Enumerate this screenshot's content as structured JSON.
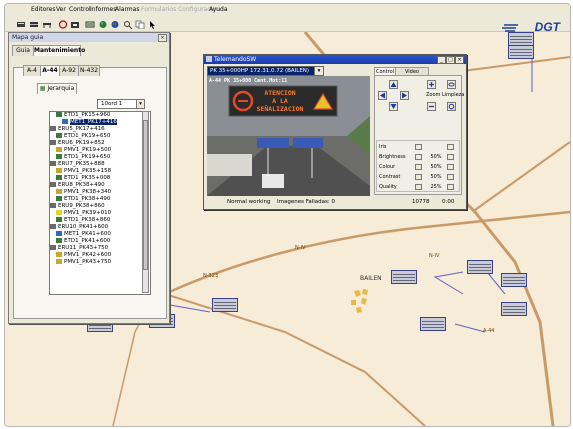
{
  "menu": [
    {
      "label": "Editores",
      "disabled": false
    },
    {
      "label": "Ver",
      "disabled": false
    },
    {
      "label": "Control",
      "disabled": false
    },
    {
      "label": "Informes",
      "disabled": false
    },
    {
      "label": "Alarmas",
      "disabled": false
    },
    {
      "label": "Formularios Configuracion",
      "disabled": true
    },
    {
      "label": "Ayuda",
      "disabled": false
    }
  ],
  "toolbar_icons": [
    "new-icon",
    "open-icon",
    "road-icon",
    "stop-icon",
    "camera-icon",
    "panel-icon",
    "globe-icon",
    "earth-icon",
    "zoom-icon",
    "copy-icon",
    "pointer-icon"
  ],
  "logo": "DGT",
  "tool_window": {
    "title": "Mapa guia",
    "tabs": [
      "Guia",
      "Mantenimiento"
    ],
    "road_tabs": [
      "A-4",
      "A-44",
      "A-92",
      "N-432"
    ],
    "subtab": "Jerarquia",
    "filter": "10ord 1",
    "tree": [
      {
        "label": "ETD1_PK15+960",
        "indent": 1,
        "icon": "station"
      },
      {
        "label": "MET1_PK17+416",
        "indent": 2,
        "icon": "meteo",
        "selected": true
      },
      {
        "label": "ERU5_PK17+416",
        "indent": 0,
        "icon": "eru"
      },
      {
        "label": "ETD1_PK19+650",
        "indent": 1,
        "icon": "station"
      },
      {
        "label": "ERU6_PK19+852",
        "indent": 0,
        "icon": "eru"
      },
      {
        "label": "PMV1_PK19+500",
        "indent": 1,
        "icon": "panel"
      },
      {
        "label": "ETD1_PK19+650",
        "indent": 1,
        "icon": "station"
      },
      {
        "label": "ERU7_PK35+888",
        "indent": 0,
        "icon": "eru"
      },
      {
        "label": "PMV1_PK35+158",
        "indent": 1,
        "icon": "panel"
      },
      {
        "label": "ETD1_PK35+008",
        "indent": 1,
        "icon": "station"
      },
      {
        "label": "ERU8_PK38+490",
        "indent": 0,
        "icon": "eru"
      },
      {
        "label": "PMV1_PK38+340",
        "indent": 1,
        "icon": "panel"
      },
      {
        "label": "ETD1_PK38+490",
        "indent": 1,
        "icon": "station"
      },
      {
        "label": "ERU9_PK38+860",
        "indent": 0,
        "icon": "eru"
      },
      {
        "label": "PMV1_PK39+010",
        "indent": 1,
        "icon": "panel-warn"
      },
      {
        "label": "ETD1_PK38+860",
        "indent": 1,
        "icon": "station"
      },
      {
        "label": "ERU10_PK41+600",
        "indent": 0,
        "icon": "eru"
      },
      {
        "label": "MET1_PK41+600",
        "indent": 1,
        "icon": "meteo"
      },
      {
        "label": "ETD1_PK41+600",
        "indent": 1,
        "icon": "station"
      },
      {
        "label": "ERU11_PK43+750",
        "indent": 0,
        "icon": "eru"
      },
      {
        "label": "PMV1_PK42+600",
        "indent": 1,
        "icon": "panel"
      },
      {
        "label": "PMV1_PK43+750",
        "indent": 1,
        "icon": "panel"
      }
    ]
  },
  "tele_window": {
    "title": "TelemandoSW",
    "camera": "PK 35+000HP 172.31.0.72 (BAILEN)",
    "osd": "A-44 PK 35+000 Cent.Mot:11",
    "sign_text": [
      "ATENCION",
      "A LA",
      "SEÑALIZACION"
    ],
    "tabs": [
      "Control",
      "Video Record"
    ],
    "zoom_label": "Zoom",
    "clean_label": "Limpieza",
    "adjustments": [
      {
        "name": "Iris",
        "value": ""
      },
      {
        "name": "Brightness",
        "value": "50%"
      },
      {
        "name": "Colour",
        "value": "50%"
      },
      {
        "name": "Contrast",
        "value": "50%"
      },
      {
        "name": "Quality",
        "value": "25%"
      }
    ],
    "status_left": "Normal working",
    "status_mid": "Imagenes Falladas: 0",
    "status_frames": "10778",
    "status_right": "0:00"
  },
  "map": {
    "town": "BAILEN",
    "roads": [
      "N-IV",
      "N-323",
      "N-IV",
      "A-44"
    ]
  }
}
